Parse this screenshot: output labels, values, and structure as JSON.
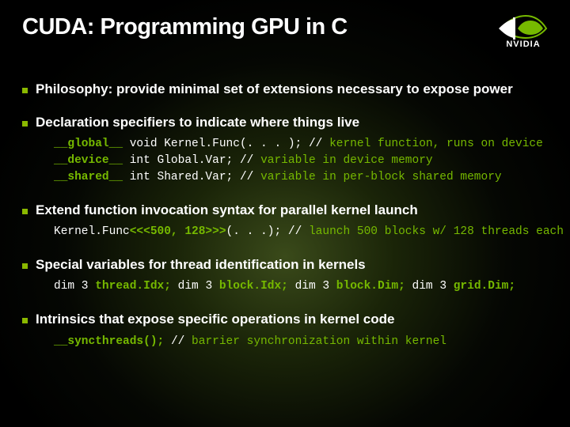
{
  "title": "CUDA: Programming GPU in C",
  "logo": {
    "text": "NVIDIA"
  },
  "points": [
    {
      "title": "Philosophy: provide minimal set of extensions necessary to expose power"
    },
    {
      "title": "Declaration specifiers to indicate where things live",
      "rows": [
        {
          "kw": "__global__",
          "mid": " void Kernel.Func(. . . );  ",
          "c": "// ",
          "cm": "kernel function, runs on device"
        },
        {
          "kw": "__device__",
          "mid": " int  Global.Var;           ",
          "c": "// ",
          "cm": "variable in device memory"
        },
        {
          "kw": "__shared__",
          "mid": " int  Shared.Var;           ",
          "c": "// ",
          "cm": "variable in per-block shared memory"
        }
      ]
    },
    {
      "title": "Extend function invocation syntax for parallel kernel launch",
      "rows": [
        {
          "pre": "Kernel.Func",
          "kw": "<<<500, 128>>>",
          "mid": "(. . .);      ",
          "c": "// ",
          "cm": "launch 500 blocks w/ 128 threads each"
        }
      ]
    },
    {
      "title": "Special variables for thread identification in kernels",
      "rows": [
        {
          "seg": [
            {
              "w": "dim 3 "
            },
            {
              "g": "thread.Idx;"
            },
            {
              "w": "   dim 3 "
            },
            {
              "g": "block.Idx;"
            },
            {
              "w": "   dim 3 "
            },
            {
              "g": "block.Dim;"
            },
            {
              "w": "   dim 3 "
            },
            {
              "g": "grid.Dim;"
            }
          ]
        }
      ]
    },
    {
      "title": "Intrinsics that expose specific operations in kernel code",
      "rows": [
        {
          "kw": "__syncthreads();",
          "mid": "                        ",
          "c": "// ",
          "cm": "barrier synchronization within kernel"
        }
      ]
    }
  ]
}
